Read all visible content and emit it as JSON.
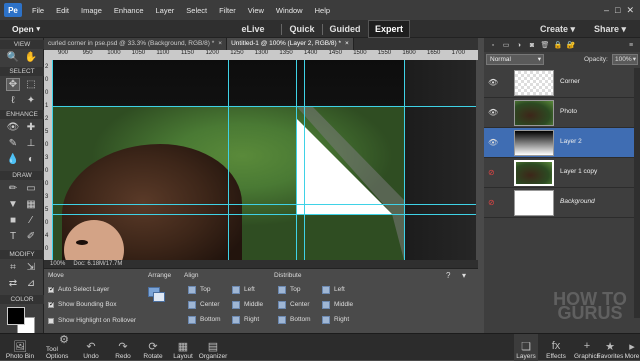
{
  "menu": {
    "app_icon": "Pe",
    "items": [
      "File",
      "Edit",
      "Image",
      "Enhance",
      "Layer",
      "Select",
      "Filter",
      "View",
      "Window",
      "Help"
    ],
    "window_controls": {
      "minimize": "–",
      "maximize": "□",
      "close": "✕"
    }
  },
  "modebar": {
    "open_label": "Open",
    "tabs": [
      "eLive",
      "Quick",
      "Guided",
      "Expert"
    ],
    "active_tab": "Expert",
    "create_label": "Create",
    "share_label": "Share"
  },
  "toolbox": {
    "sections": [
      "VIEW",
      "SELECT",
      "ENHANCE",
      "DRAW",
      "MODIFY",
      "COLOR"
    ]
  },
  "documents": {
    "tabs": [
      {
        "title": "curled corner in pse.psd @ 33.3% (Background, RGB/8) *",
        "close": "×",
        "active": false
      },
      {
        "title": "Untitled-1 @ 100% (Layer 2, RGB/8) *",
        "close": "×",
        "active": true
      }
    ]
  },
  "ruler": {
    "h_ticks": [
      "900",
      "950",
      "1000",
      "1050",
      "1100",
      "1150",
      "1200",
      "1250",
      "1300",
      "1350",
      "1400",
      "1450",
      "1500",
      "1550",
      "1600",
      "1650",
      "1700"
    ],
    "v_ticks": [
      "2",
      "0",
      "0",
      "1",
      "2",
      "5",
      "0",
      "3",
      "0",
      "0",
      "3",
      "5",
      "0",
      "4",
      "0"
    ]
  },
  "status": {
    "zoom": "100%",
    "doc": "Doc: 6.18M/17.7M"
  },
  "options": {
    "move_title": "Move",
    "auto_select": "Auto Select Layer",
    "bounding_box": "Show Bounding Box",
    "highlight": "Show Highlight on Rollover",
    "arrange_title": "Arrange",
    "align_title": "Align",
    "align_items": [
      "Top",
      "Center",
      "Bottom",
      "Left",
      "Middle",
      "Right"
    ],
    "distribute_title": "Distribute",
    "distribute_items": [
      "Top",
      "Center",
      "Bottom",
      "Left",
      "Middle",
      "Right"
    ]
  },
  "layers": {
    "blend_mode": "Normal",
    "opacity_label": "Opacity:",
    "opacity_value": "100%",
    "rows": [
      {
        "name": "Corner",
        "active": false,
        "italic": false
      },
      {
        "name": "Photo",
        "active": false,
        "italic": false
      },
      {
        "name": "Layer 2",
        "active": true,
        "italic": false
      },
      {
        "name": "Layer 1 copy",
        "active": false,
        "italic": false
      },
      {
        "name": "Background",
        "active": false,
        "italic": true
      }
    ]
  },
  "bottom": {
    "left": [
      "Photo Bin",
      "Tool Options",
      "Undo",
      "Redo",
      "Rotate",
      "Layout",
      "Organizer"
    ],
    "right": [
      "Layers",
      "Effects",
      "Graphics",
      "Favorites",
      "More"
    ]
  },
  "watermark": "HOW TO GURUS",
  "colors": {
    "accent": "#3f6db3",
    "guide": "#3fd2e6"
  }
}
